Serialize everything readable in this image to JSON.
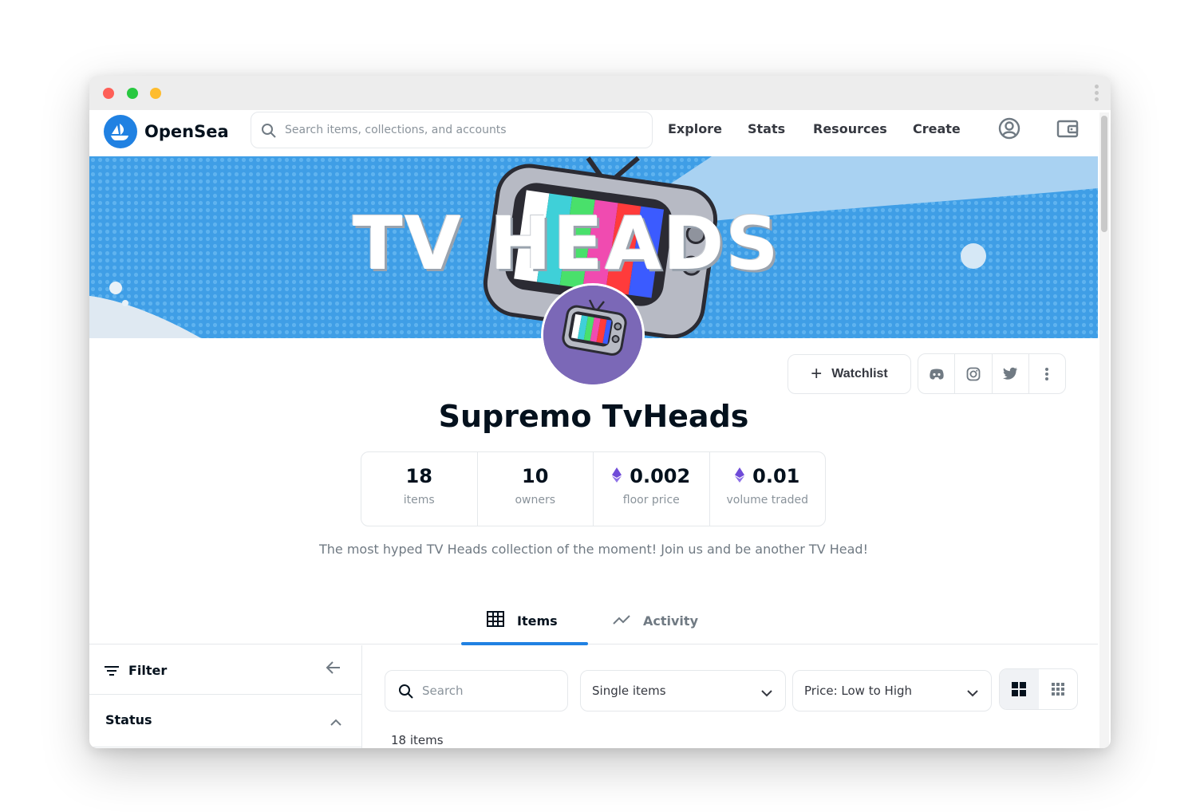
{
  "brand": {
    "name": "OpenSea"
  },
  "search": {
    "placeholder": "Search items, collections, and accounts"
  },
  "nav": {
    "items": [
      "Explore",
      "Stats",
      "Resources",
      "Create"
    ]
  },
  "banner": {
    "title": "TV HEADS"
  },
  "collection": {
    "name": "Supremo TvHeads",
    "description": "The most hyped TV Heads collection of the moment! Join us and be another TV Head!"
  },
  "actions": {
    "watchlist_label": "Watchlist"
  },
  "stats": [
    {
      "value": "18",
      "label": "items"
    },
    {
      "value": "10",
      "label": "owners"
    },
    {
      "value": "0.002",
      "label": "floor price"
    },
    {
      "value": "0.01",
      "label": "volume traded"
    }
  ],
  "tabs": [
    {
      "label": "Items"
    },
    {
      "label": "Activity"
    }
  ],
  "filter": {
    "label": "Filter",
    "status_label": "Status"
  },
  "toolbar": {
    "search_placeholder": "Search",
    "item_type": "Single items",
    "sort": "Price: Low to High"
  },
  "results": {
    "count_text": "18 items"
  },
  "colors": {
    "accent": "#2081e2",
    "eth": "#6f4bd8",
    "border": "#e5e8eb"
  }
}
